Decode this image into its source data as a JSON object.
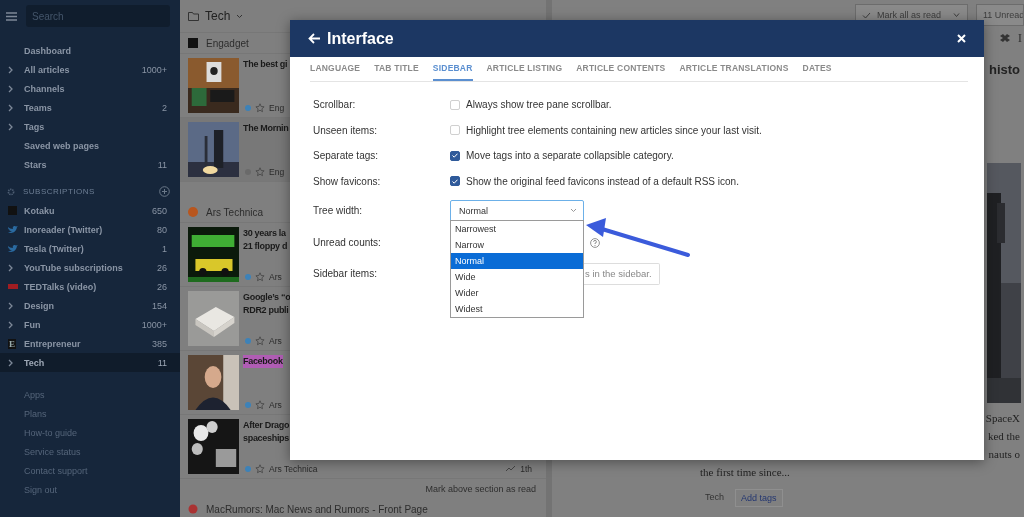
{
  "sidebar": {
    "search": {
      "placeholder": "Search"
    },
    "nav": [
      {
        "label": "Dashboard",
        "expandable": false
      },
      {
        "label": "All articles",
        "count": "1000+",
        "expandable": true
      },
      {
        "label": "Channels",
        "expandable": true
      },
      {
        "label": "Teams",
        "count": "2",
        "expandable": true
      },
      {
        "label": "Tags",
        "expandable": true
      },
      {
        "label": "Saved web pages",
        "expandable": false
      },
      {
        "label": "Stars",
        "count": "11",
        "expandable": false
      }
    ],
    "subscriptions_title": "SUBSCRIPTIONS",
    "feeds": [
      {
        "label": "Kotaku",
        "count": "650",
        "selected": false
      },
      {
        "label": "Inoreader (Twitter)",
        "count": "80",
        "selected": false
      },
      {
        "label": "Tesla (Twitter)",
        "count": "1",
        "selected": false
      },
      {
        "label": "YouTube subscriptions",
        "count": "26",
        "selected": false
      },
      {
        "label": "TEDTalks (video)",
        "count": "26",
        "selected": false
      },
      {
        "label": "Design",
        "count": "154",
        "selected": false
      },
      {
        "label": "Fun",
        "count": "1000+",
        "selected": false
      },
      {
        "label": "Entrepreneur",
        "count": "385",
        "icon_text": "E",
        "selected": false
      },
      {
        "label": "Tech",
        "count": "11",
        "selected": true
      }
    ],
    "links": [
      "Apps",
      "Plans",
      "How-to guide",
      "Service status",
      "Contact support",
      "Sign out"
    ]
  },
  "list": {
    "folder": "Tech",
    "groups": [
      {
        "source": "Engadget",
        "articles": [
          {
            "title": "The best gi",
            "highlighted": false,
            "meta": "Eng",
            "read": false
          },
          {
            "title": "The Mornin",
            "highlighted": false,
            "meta": "Eng",
            "read": true
          }
        ]
      },
      {
        "source": "Ars Technica",
        "articles": [
          {
            "title": "30 years la\n21 floppy d",
            "highlighted": false,
            "meta": "Ars",
            "read": false
          },
          {
            "title": "Google’s “o\nRDR2 publi",
            "highlighted": false,
            "meta": "Ars",
            "read": false
          },
          {
            "title": "Facebook",
            "highlighted": true,
            "meta": "Ars",
            "read": false
          },
          {
            "title": "After Drago\nspaceships",
            "highlighted": false,
            "meta": "Ars Technica",
            "time": "1th",
            "read": false
          }
        ]
      }
    ],
    "mark_section": "Mark above section as read",
    "next_group": "MacRumors: Mac News and Rumors - Front Page"
  },
  "article": {
    "mark_all": "Mark all as read",
    "unread": "11 Unread",
    "toolbar_text": "I",
    "heading": "histo",
    "lines": [
      "SpaceX",
      "ked the",
      "nauts o",
      "the first time since..."
    ],
    "tags": [
      "Tech"
    ],
    "add_tags": "Add tags"
  },
  "dialog": {
    "title": "Interface",
    "tabs": [
      {
        "label": "LANGUAGE",
        "selected": false
      },
      {
        "label": "TAB TITLE",
        "selected": false
      },
      {
        "label": "SIDEBAR",
        "selected": true
      },
      {
        "label": "ARTICLE LISTING",
        "selected": false
      },
      {
        "label": "ARTICLE CONTENTS",
        "selected": false
      },
      {
        "label": "ARTICLE TRANSLATIONS",
        "selected": false
      },
      {
        "label": "DATES",
        "selected": false
      }
    ],
    "settings": [
      {
        "kind": "checkbox",
        "label": "Scrollbar:",
        "text": "Always show tree pane scrollbar.",
        "checked": false
      },
      {
        "kind": "checkbox",
        "label": "Unseen items:",
        "text": "Highlight tree elements containing new articles since your last visit.",
        "checked": false
      },
      {
        "kind": "checkbox",
        "label": "Separate tags:",
        "text": "Move tags into a separate collapsible category.",
        "checked": true
      },
      {
        "kind": "checkbox",
        "label": "Show favicons:",
        "text": "Show the original feed favicons instead of a default RSS icon.",
        "checked": true
      },
      {
        "kind": "select",
        "label": "Tree width:",
        "value": "Normal",
        "expanded": true,
        "options": [
          {
            "label": "Narrowest",
            "selected": false
          },
          {
            "label": "Narrow",
            "selected": false
          },
          {
            "label": "Normal",
            "selected": true
          },
          {
            "label": "Wide",
            "selected": false
          },
          {
            "label": "Wider",
            "selected": false
          },
          {
            "label": "Widest",
            "selected": false
          }
        ]
      },
      {
        "kind": "help",
        "label": "Unread counts:"
      },
      {
        "kind": "button",
        "label": "Sidebar items:",
        "text": "s in the sidebar."
      }
    ]
  }
}
